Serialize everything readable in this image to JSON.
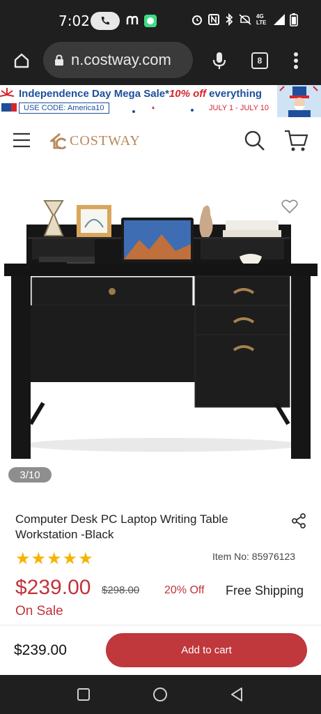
{
  "status_bar": {
    "time": "7:02",
    "network": "4G LTE"
  },
  "browser": {
    "url": "n.costway.com",
    "tab_count": "8"
  },
  "promo": {
    "title_prefix": "Independence Day Mega Sale*",
    "title_highlight": "10% off",
    "title_suffix": " everything",
    "code": "USE CODE:  America10",
    "dates": "JULY 1 - JULY 10"
  },
  "header": {
    "logo": "COSTWAY",
    "menu_icon": "hamburger-icon",
    "search_icon": "search-icon",
    "cart_icon": "cart-icon"
  },
  "gallery": {
    "counter": "3/10",
    "wishlist_icon": "heart-icon"
  },
  "product": {
    "title": "Computer Desk PC Laptop Writing Table Workstation -Black",
    "rating_stars": 5,
    "item_no": "Item No: 85976123",
    "price": "$239.00",
    "old_price": "$298.00",
    "discount": "20% Off",
    "shipping": "Free Shipping",
    "status": "On Sale"
  },
  "cart_bar": {
    "price": "$239.00",
    "button": "Add to cart"
  },
  "colors": {
    "accent": "#c0373c",
    "star": "#f4b400",
    "logo": "#b7895b"
  }
}
